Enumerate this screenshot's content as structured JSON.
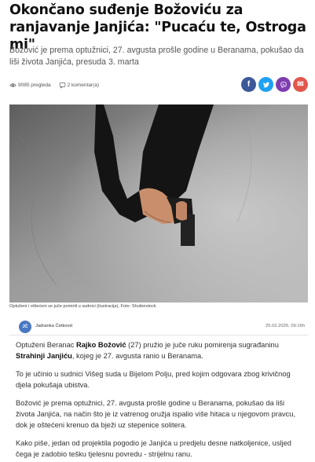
{
  "article": {
    "title": "Okončano suđenje Božoviću za ranjavanje Janjića: \"Pucaću te, Ostroga mi\"",
    "lead": "Božović je prema optužnici, 27. avgusta prošle godine u Beranama, pokušao da liši života Janjića, presuda 3. marta",
    "views": "9085 pregleda",
    "comments": "2 komentar(a)",
    "caption": "Optuženi i oštećeni se juče pomirili u sudnici (ilustracija), Foto: Shutterstock"
  },
  "share": {
    "facebook": "f",
    "twitter": "t",
    "viber": "v",
    "email": "✉",
    "colors": {
      "facebook": "#3b5998",
      "twitter": "#1da1f2",
      "viber": "#7d3daf",
      "email": "#e2574c"
    }
  },
  "author": {
    "initials": "JČ",
    "name": "Jadranka Ćetković",
    "date": "25.02.2025. 09:16h"
  },
  "body": {
    "p1_pre": "Optuženi Beranac ",
    "p1_name1": "Rajko Božović",
    "p1_mid": " (27) pružio je juče ruku pomirenja sugrađaninu ",
    "p1_name2": "Strahinji Janjiću",
    "p1_post": ", kojeg je 27. avgusta ranio u Beranama.",
    "p2": "To je učinio u sudnici Višeg suda u Bijelom Polju, pred kojim odgovara zbog krivičnog djela pokušaja ubistva.",
    "p3": "Božović je prema optužnici, 27. avgusta prošle godine u Beranama, pokušao da liši života Janjića, na način što je iz vatrenog oružja ispalio više hitaca u njegovom pravcu, dok je oštećeni krenuo da bježi uz stepenice solitera.",
    "p4": "Kako piše, jedan od projektila pogodio je Janjića u predjelu desne natkoljenice, usljed čega je zadobio tešku tjelesnu povredu - strijelnu ranu."
  }
}
